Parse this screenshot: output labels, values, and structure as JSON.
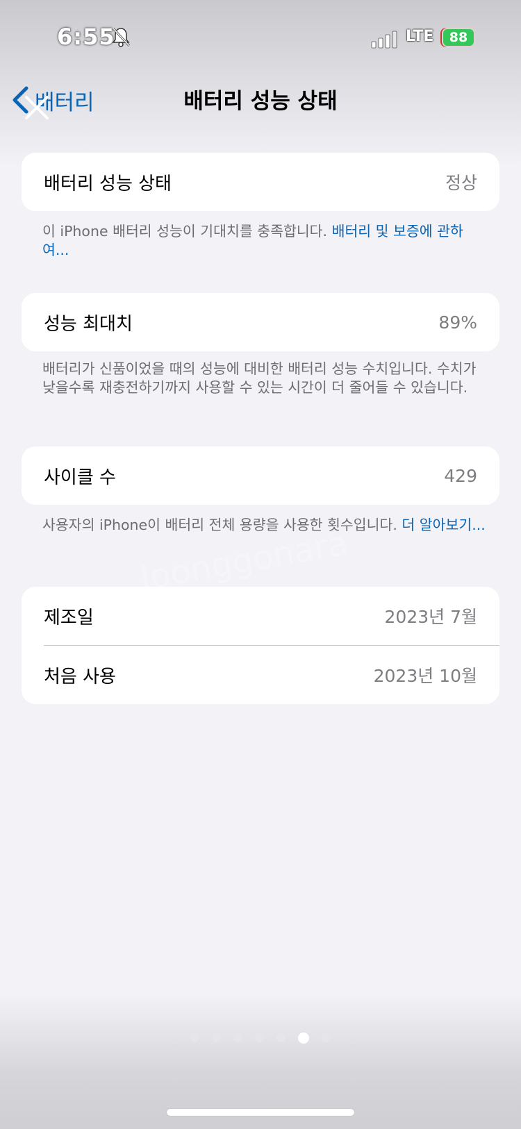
{
  "status_bar": {
    "time": "6:55",
    "network": "LTE",
    "battery_level": "88"
  },
  "nav": {
    "back_label": "배터리",
    "title": "배터리 성능 상태"
  },
  "sections": {
    "health": {
      "label": "배터리 성능 상태",
      "value": "정상",
      "footnote_text": "이 iPhone 배터리 성능이 기대치를 충족합니다. ",
      "footnote_link": "배터리 및 보증에 관하여..."
    },
    "max_capacity": {
      "label": "성능 최대치",
      "value": "89%",
      "footnote_text": "배터리가 신품이었을 때의 성능에 대비한 배터리 성능 수치입니다. 수치가 낮을수록 재충전하기까지 사용할 수 있는 시간이 더 줄어들 수 있습니다."
    },
    "cycle_count": {
      "label": "사이클 수",
      "value": "429",
      "footnote_text": "사용자의 iPhone이 배터리 전체 용량을 사용한 횟수입니다. ",
      "footnote_link": "더 알아보기..."
    },
    "dates": {
      "manufacture_label": "제조일",
      "manufacture_value": "2023년 7월",
      "first_use_label": "처음 사용",
      "first_use_value": "2023년 10월"
    }
  },
  "page_indicator": {
    "total": 7,
    "current": 6
  },
  "watermark": "Joonggonara",
  "colors": {
    "link": "#0a64b4",
    "battery": "#34c759",
    "background": "#f2f2f7"
  }
}
